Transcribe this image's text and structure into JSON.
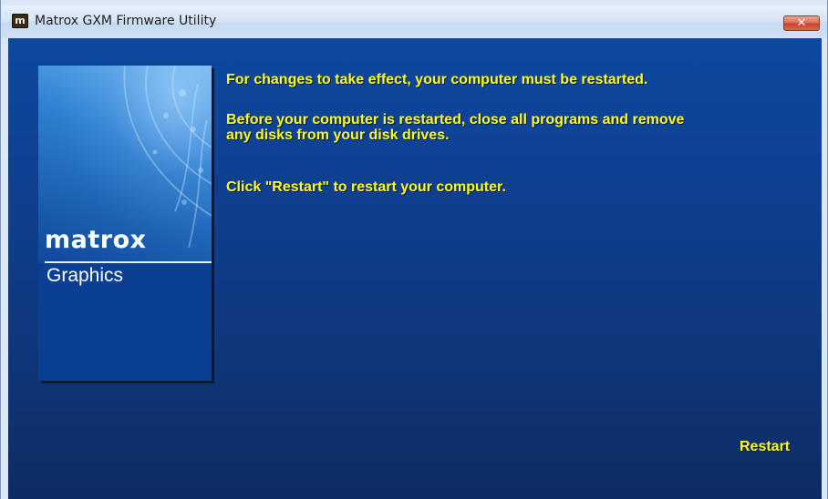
{
  "window": {
    "title": "Matrox GXM Firmware Utility",
    "app_icon_glyph": "m",
    "close_glyph": "✕"
  },
  "side_panel": {
    "logo_word": "matrox",
    "logo_sub": "Graphics"
  },
  "messages": {
    "line1": "For changes to take effect, your computer must be restarted.",
    "line2": "Before your computer is restarted, close all programs and remove\nany disks from your disk drives.",
    "line3": "Click \"Restart\" to restart your computer."
  },
  "actions": {
    "restart_label": "Restart"
  },
  "colors": {
    "text_accent": "#ffff1e",
    "background": "#0e3a82"
  },
  "icons": {
    "app": "matrox-app-icon",
    "close": "close-icon"
  }
}
